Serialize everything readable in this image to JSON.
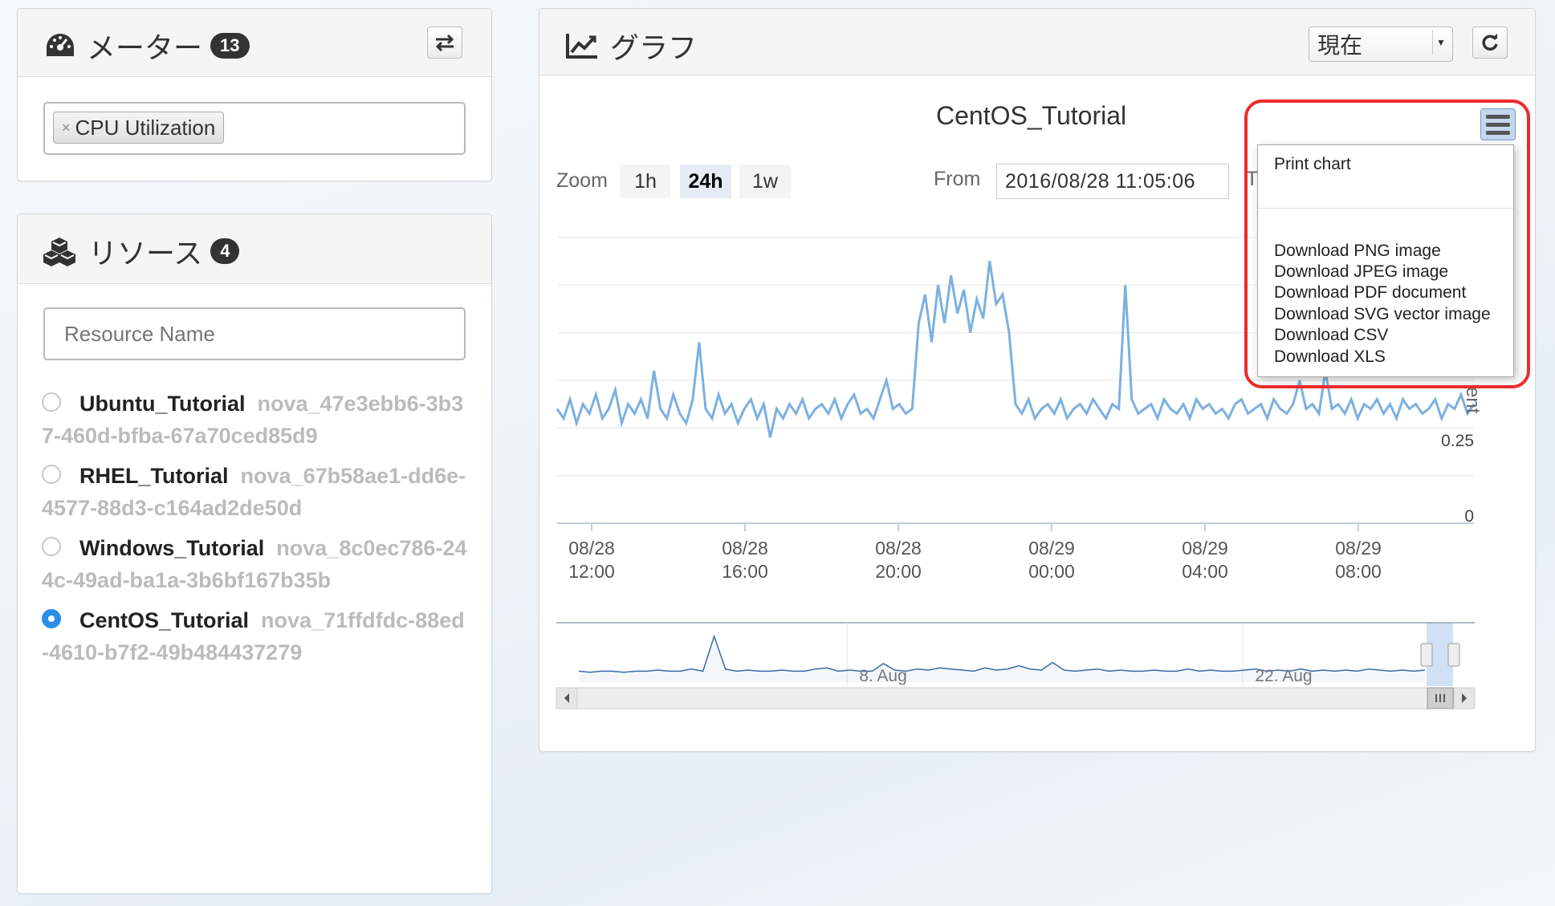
{
  "meters": {
    "title": "メーター",
    "count": "13",
    "selected_tag": "CPU Utilization",
    "tag_remove": "×"
  },
  "resources": {
    "title": "リソース",
    "count": "4",
    "search_placeholder": "Resource Name",
    "items": [
      {
        "name": "Ubuntu_Tutorial",
        "id": "nova_47e3ebb6-3b37-460d-bfba-67a70ced85d9",
        "selected": false
      },
      {
        "name": "RHEL_Tutorial",
        "id": "nova_67b58ae1-dd6e-4577-88d3-c164ad2de50d",
        "selected": false
      },
      {
        "name": "Windows_Tutorial",
        "id": "nova_8c0ec786-244c-49ad-ba1a-3b6bf167b35b",
        "selected": false
      },
      {
        "name": "CentOS_Tutorial",
        "id": "nova_71ffdfdc-88ed-4610-b7f2-49b484437279",
        "selected": true
      }
    ]
  },
  "graph": {
    "title": "グラフ",
    "period_select": "現在",
    "chart_title": "CentOS_Tutorial",
    "zoom_label": "Zoom",
    "zoom_options": [
      "1h",
      "24h",
      "1w"
    ],
    "zoom_selected": "24h",
    "from_label": "From",
    "from_value": "2016/08/28 11:05:06",
    "to_label_partial": "T",
    "y_axis_partial": "ent"
  },
  "export_menu": {
    "items": [
      "Print chart",
      "Download PNG image",
      "Download JPEG image",
      "Download PDF document",
      "Download SVG vector image",
      "Download CSV",
      "Download XLS"
    ]
  },
  "chart_data": {
    "type": "line",
    "x_ticks": [
      "08/28 12:00",
      "08/28 16:00",
      "08/28 20:00",
      "08/29 00:00",
      "08/29 04:00",
      "08/29 08:00"
    ],
    "y_ticks_visible": [
      "0.25",
      "0"
    ],
    "series": [
      {
        "color": "#7cb0e0",
        "values": [
          0.24,
          0.22,
          0.26,
          0.21,
          0.25,
          0.23,
          0.27,
          0.22,
          0.24,
          0.28,
          0.21,
          0.25,
          0.23,
          0.26,
          0.22,
          0.32,
          0.24,
          0.22,
          0.27,
          0.23,
          0.21,
          0.26,
          0.38,
          0.24,
          0.22,
          0.27,
          0.23,
          0.25,
          0.21,
          0.24,
          0.26,
          0.22,
          0.25,
          0.18,
          0.24,
          0.22,
          0.25,
          0.23,
          0.26,
          0.22,
          0.24,
          0.25,
          0.23,
          0.26,
          0.22,
          0.25,
          0.27,
          0.23,
          0.24,
          0.22,
          0.26,
          0.3,
          0.24,
          0.25,
          0.23,
          0.24,
          0.42,
          0.48,
          0.38,
          0.5,
          0.42,
          0.52,
          0.44,
          0.49,
          0.4,
          0.47,
          0.43,
          0.55,
          0.46,
          0.48,
          0.4,
          0.25,
          0.23,
          0.26,
          0.22,
          0.24,
          0.25,
          0.23,
          0.26,
          0.22,
          0.24,
          0.25,
          0.23,
          0.26,
          0.24,
          0.22,
          0.25,
          0.24,
          0.5,
          0.26,
          0.23,
          0.24,
          0.25,
          0.22,
          0.26,
          0.24,
          0.23,
          0.25,
          0.22,
          0.26,
          0.24,
          0.25,
          0.23,
          0.24,
          0.22,
          0.25,
          0.26,
          0.23,
          0.24,
          0.25,
          0.22,
          0.26,
          0.24,
          0.23,
          0.25,
          0.3,
          0.24,
          0.25,
          0.23,
          0.32,
          0.24,
          0.25,
          0.23,
          0.26,
          0.22,
          0.25,
          0.24,
          0.26,
          0.23,
          0.25,
          0.22,
          0.26,
          0.24,
          0.25,
          0.23,
          0.24,
          0.26,
          0.22,
          0.25,
          0.24,
          0.27,
          0.23,
          0.25
        ]
      }
    ],
    "navigator": {
      "x_labels": [
        "8. Aug",
        "22. Aug"
      ],
      "values": [
        0.1,
        0.09,
        0.1,
        0.1,
        0.09,
        0.1,
        0.1,
        0.11,
        0.1,
        0.1,
        0.12,
        0.1,
        0.42,
        0.12,
        0.1,
        0.11,
        0.1,
        0.1,
        0.11,
        0.1,
        0.1,
        0.12,
        0.13,
        0.1,
        0.11,
        0.1,
        0.1,
        0.17,
        0.11,
        0.1,
        0.12,
        0.11,
        0.13,
        0.12,
        0.11,
        0.1,
        0.13,
        0.11,
        0.12,
        0.15,
        0.12,
        0.11,
        0.18,
        0.11,
        0.1,
        0.11,
        0.12,
        0.1,
        0.11,
        0.1,
        0.1,
        0.11,
        0.1,
        0.1,
        0.12,
        0.1,
        0.11,
        0.1,
        0.1,
        0.11,
        0.12,
        0.1,
        0.11,
        0.1,
        0.12,
        0.1,
        0.11,
        0.1,
        0.11,
        0.1,
        0.12,
        0.11,
        0.1,
        0.11,
        0.1,
        0.11
      ]
    }
  }
}
